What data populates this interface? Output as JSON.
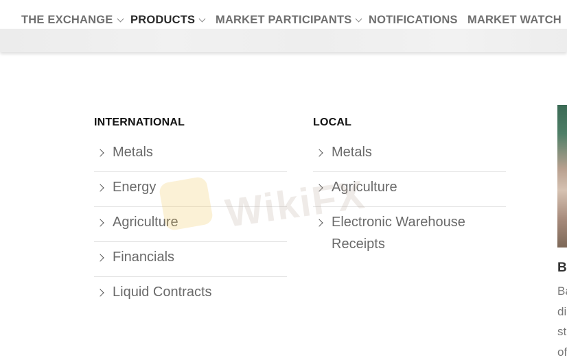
{
  "nav": {
    "items": [
      {
        "label": "THE EXCHANGE",
        "has_dropdown": true
      },
      {
        "label": "PRODUCTS",
        "has_dropdown": true,
        "active": true
      },
      {
        "label": "MARKET PARTICIPANTS",
        "has_dropdown": true
      },
      {
        "label": "NOTIFICATIONS",
        "has_dropdown": false
      },
      {
        "label": "MARKET WATCH",
        "has_dropdown": false
      }
    ]
  },
  "dropdown": {
    "international": {
      "title": "INTERNATIONAL",
      "items": [
        "Metals",
        "Energy",
        "Agriculture",
        "Financials",
        "Liquid Contracts"
      ]
    },
    "local": {
      "title": "LOCAL",
      "items": [
        "Metals",
        "Agriculture",
        "Electronic Warehouse Receipts"
      ]
    }
  },
  "side_preview": {
    "heading": "B",
    "lines": [
      "Ba",
      "di",
      "st",
      "of"
    ]
  },
  "watermark": "WikiFX",
  "colors": {
    "nav_text": "#6f6f6f",
    "nav_active": "#2a2a2a",
    "menu_text": "#6a6a6a",
    "divider": "#e3e3e3"
  }
}
